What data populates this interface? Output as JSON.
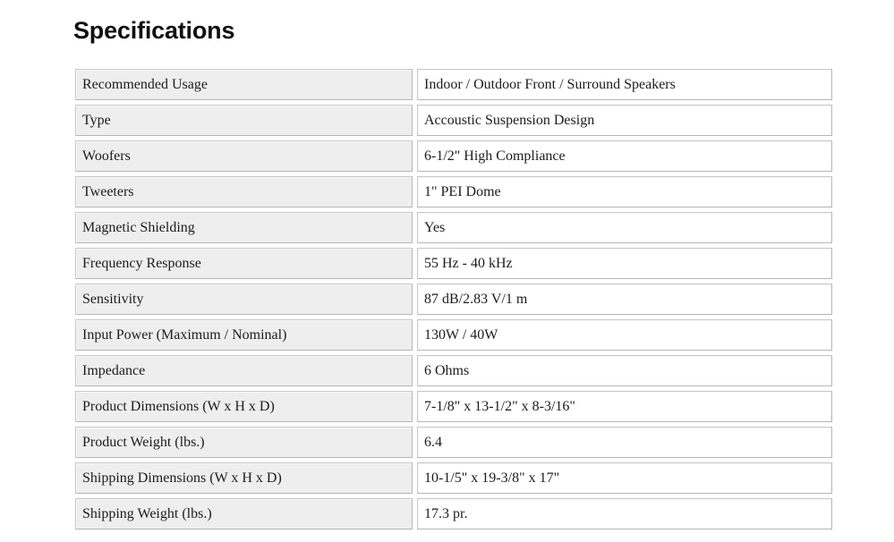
{
  "document": {
    "title": "Specifications"
  },
  "spec_table": {
    "rows": [
      {
        "label": "Recommended Usage",
        "value": "Indoor / Outdoor Front / Surround Speakers"
      },
      {
        "label": "Type",
        "value": "Accoustic Suspension Design"
      },
      {
        "label": "Woofers",
        "value": "6-1/2\" High Compliance"
      },
      {
        "label": "Tweeters",
        "value": "1\" PEI Dome"
      },
      {
        "label": "Magnetic Shielding",
        "value": "Yes"
      },
      {
        "label": "Frequency Response",
        "value": "55 Hz - 40 kHz"
      },
      {
        "label": "Sensitivity",
        "value": "87 dB/2.83 V/1 m"
      },
      {
        "label": "Input Power (Maximum / Nominal)",
        "value": "130W / 40W"
      },
      {
        "label": "Impedance",
        "value": "6 Ohms"
      },
      {
        "label": "Product Dimensions (W x H x D)",
        "value": "7-1/8\" x 13-1/2\" x 8-3/16\""
      },
      {
        "label": "Product Weight (lbs.)",
        "value": "6.4"
      },
      {
        "label": "Shipping Dimensions (W x H x D)",
        "value": "10-1/5\" x 19-3/8\" x 17\""
      },
      {
        "label": "Shipping Weight (lbs.)",
        "value": "17.3 pr."
      }
    ]
  },
  "colors": {
    "page_background": "#ffffff",
    "label_cell_background": "#eeeeee",
    "value_cell_background": "#ffffff",
    "cell_border": "#c8c8c8",
    "text": "#1c1c1c",
    "title_text": "#111111"
  }
}
